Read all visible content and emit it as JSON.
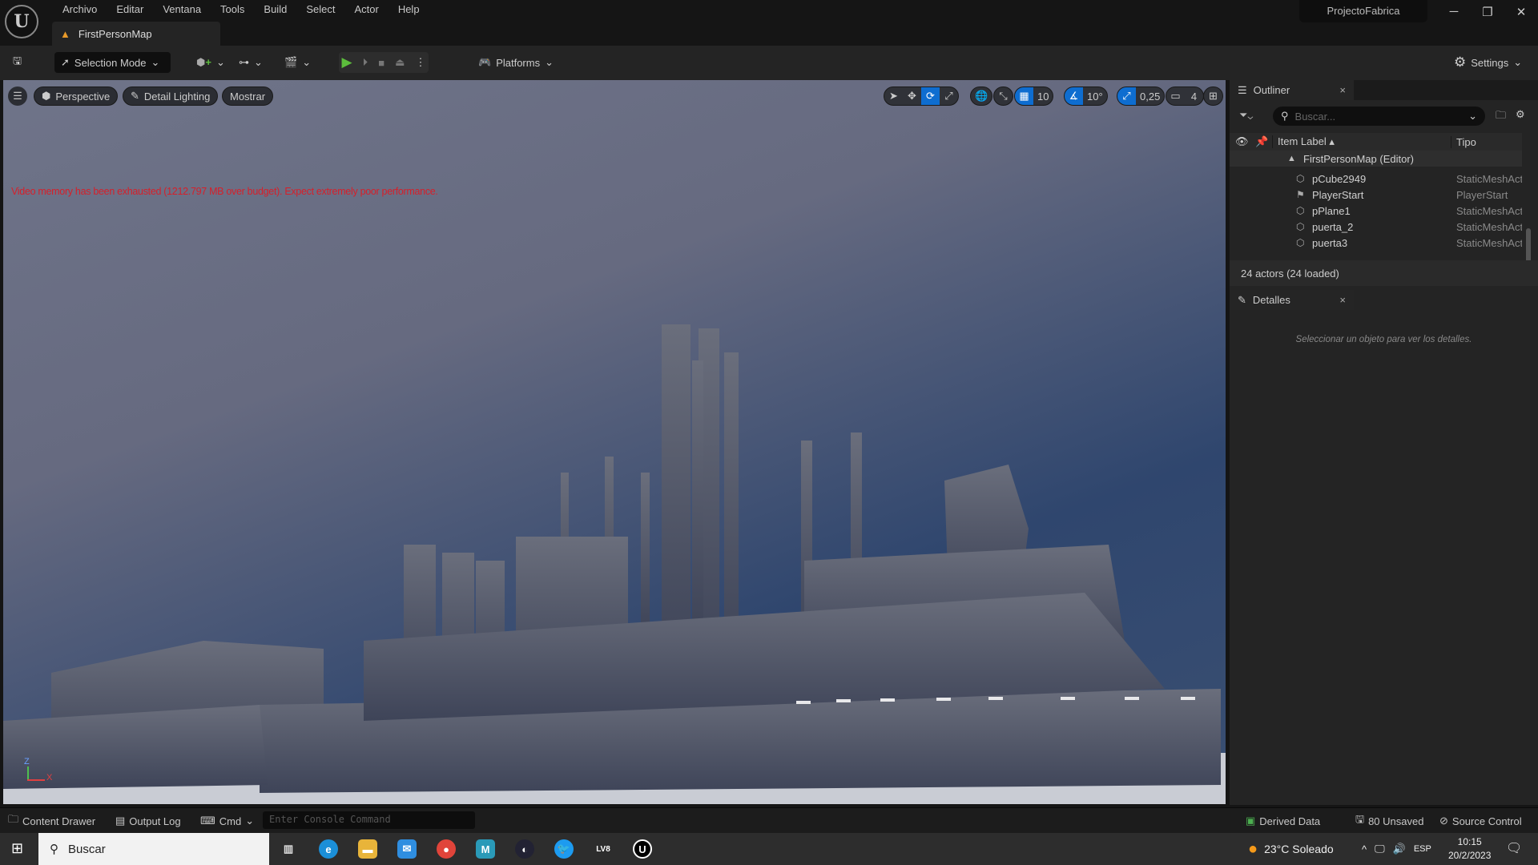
{
  "app": {
    "project": "ProjectoFabrica",
    "logo_text": "U"
  },
  "menu": [
    "Archivo",
    "Editar",
    "Ventana",
    "Tools",
    "Build",
    "Select",
    "Actor",
    "Help"
  ],
  "doc_tab": "FirstPersonMap",
  "toolbar": {
    "selection_mode": "Selection Mode",
    "platforms": "Platforms",
    "settings": "Settings"
  },
  "viewport": {
    "perspective": "Perspective",
    "lighting": "Detail Lighting",
    "show": "Mostrar",
    "grid_snap": "10",
    "rot_snap": "10°",
    "scale_snap": "0,25",
    "camera_speed": "4",
    "warning": "Video memory has been exhausted (1212.797 MB over budget). Expect extremely poor performance.",
    "axis_z": "Z",
    "axis_x": "X"
  },
  "outliner": {
    "title": "Outliner",
    "search_placeholder": "Buscar...",
    "col_label": "Item Label",
    "col_type": "Tipo",
    "root": "FirstPersonMap (Editor)",
    "rows": [
      {
        "label": "pCube2949",
        "type": "StaticMeshActor",
        "icon": "mesh-icon"
      },
      {
        "label": "PlayerStart",
        "type": "PlayerStart",
        "icon": "player-start-icon"
      },
      {
        "label": "pPlane1",
        "type": "StaticMeshActor",
        "icon": "mesh-icon"
      },
      {
        "label": "puerta_2",
        "type": "StaticMeshActor",
        "icon": "mesh-icon"
      },
      {
        "label": "puerta3",
        "type": "StaticMeshActor",
        "icon": "mesh-icon"
      }
    ],
    "status": "24 actors (24 loaded)"
  },
  "details": {
    "title": "Detalles",
    "empty": "Seleccionar un objeto para ver los detalles."
  },
  "bottom": {
    "content_drawer": "Content Drawer",
    "output_log": "Output Log",
    "cmd": "Cmd",
    "console_placeholder": "Enter Console Command",
    "derived_data": "Derived Data",
    "unsaved": "80 Unsaved",
    "source_control": "Source Control"
  },
  "taskbar": {
    "search": "Buscar",
    "weather": "23°C  Soleado",
    "lang": "ESP",
    "time": "10:15",
    "date": "20/2/2023"
  },
  "colors": {
    "accent": "#0e6dd0",
    "play": "#5cbd3c",
    "warning": "#d61f2a"
  }
}
